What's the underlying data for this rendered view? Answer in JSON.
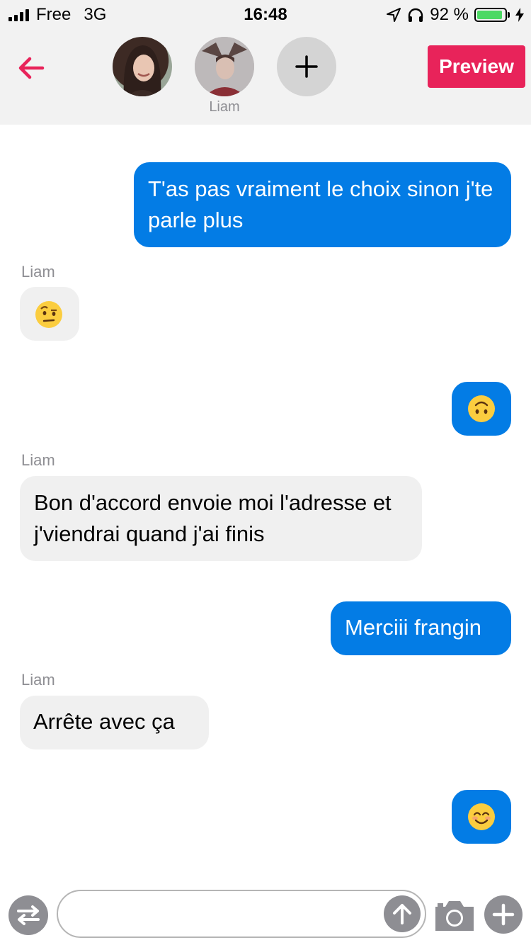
{
  "status_bar": {
    "carrier": "Free",
    "network": "3G",
    "time": "16:48",
    "battery_percent": "92 %",
    "battery_level": 0.92,
    "icons": [
      "signal-icon",
      "location-arrow-icon",
      "headphones-icon",
      "battery-icon",
      "charging-bolt-icon"
    ]
  },
  "header": {
    "back_icon": "back-arrow-icon",
    "participants": [
      {
        "name": "",
        "avatar": "avatar-girl"
      },
      {
        "name": "Liam",
        "avatar": "avatar-liam"
      }
    ],
    "add_icon": "plus-icon",
    "preview_label": "Preview"
  },
  "messages": [
    {
      "direction": "outgoing",
      "text": "T'as pas vraiment le choix sinon j'te parle plus"
    },
    {
      "direction": "incoming",
      "sender": "Liam",
      "emoji": "face-with-raised-eyebrow"
    },
    {
      "direction": "outgoing",
      "emoji": "upside-down-face"
    },
    {
      "direction": "incoming",
      "sender": "Liam",
      "text": "Bon d'accord envoie moi l'adresse et j'viendrai quand j'ai finis"
    },
    {
      "direction": "outgoing",
      "text": "Merciii frangin"
    },
    {
      "direction": "incoming",
      "sender": "Liam",
      "text": "Arrête avec ça"
    },
    {
      "direction": "outgoing",
      "emoji": "smiling-face-with-smiling-eyes"
    }
  ],
  "composer": {
    "input_value": "",
    "input_placeholder": "",
    "icons": [
      "swap-icon",
      "send-arrow-icon",
      "camera-icon",
      "plus-icon"
    ]
  },
  "colors": {
    "outgoing_bubble": "#037ce5",
    "incoming_bubble": "#f0f0f0",
    "accent": "#e8235a",
    "header_bg": "#f2f2f2",
    "battery_fill": "#4cd964"
  }
}
